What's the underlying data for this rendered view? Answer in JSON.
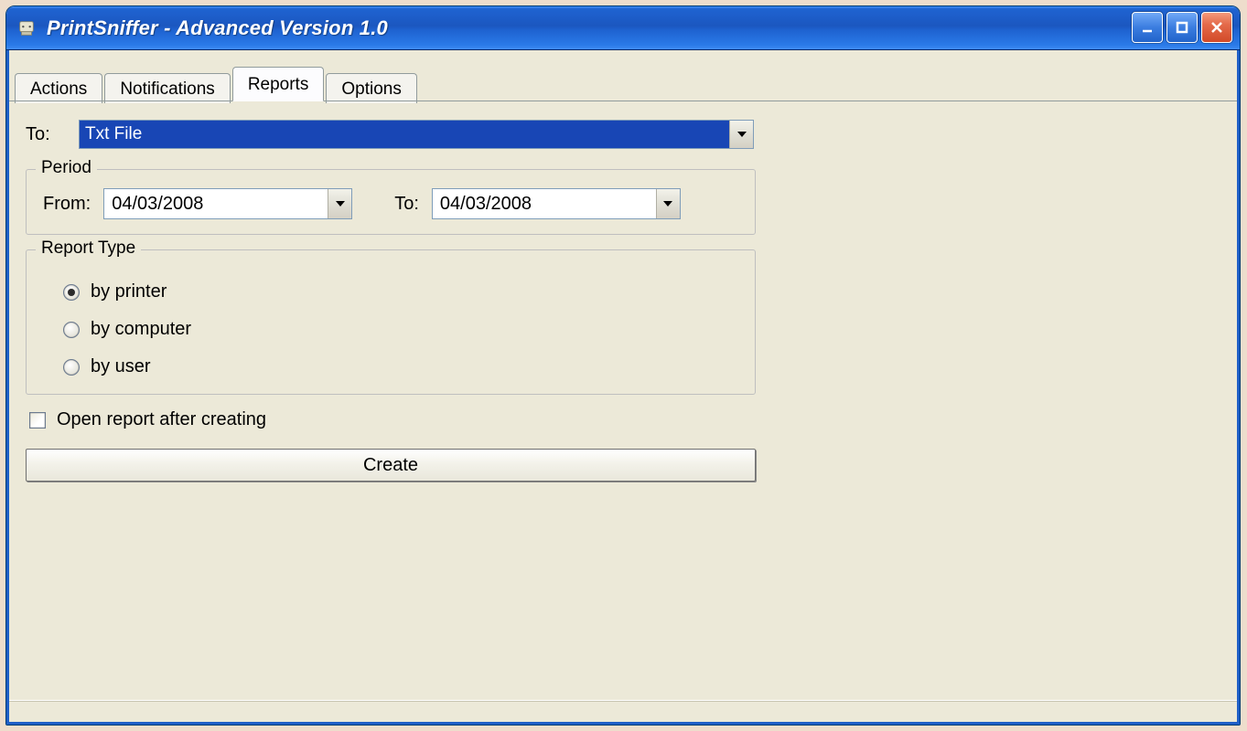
{
  "window": {
    "title": "PrintSniffer - Advanced Version 1.0"
  },
  "tabs": [
    {
      "label": "Actions"
    },
    {
      "label": "Notifications"
    },
    {
      "label": "Reports",
      "active": true
    },
    {
      "label": "Options"
    }
  ],
  "reports": {
    "to_label": "To:",
    "to_value": "Txt File",
    "period": {
      "legend": "Period",
      "from_label": "From:",
      "from_value": "04/03/2008",
      "to_label": "To:",
      "to_value": "04/03/2008"
    },
    "report_type": {
      "legend": "Report Type",
      "options": [
        {
          "label": "by printer",
          "selected": true
        },
        {
          "label": "by computer",
          "selected": false
        },
        {
          "label": "by user",
          "selected": false
        }
      ]
    },
    "open_after_label": "Open report after creating",
    "open_after_checked": false,
    "create_button": "Create"
  }
}
